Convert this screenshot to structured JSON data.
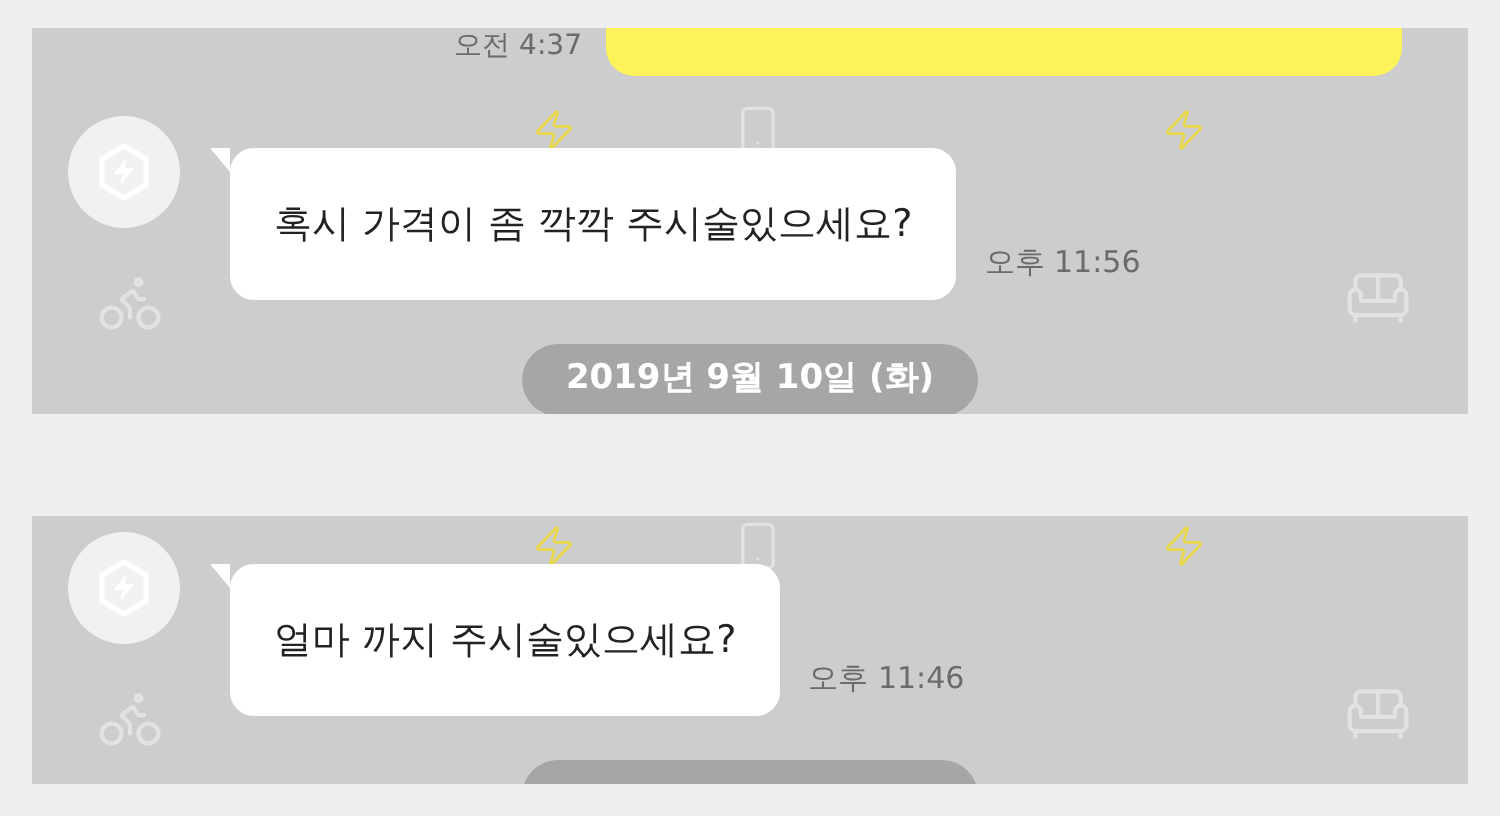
{
  "panels": [
    {
      "items": [
        {
          "kind": "outgoing",
          "time": "오전 4:37"
        },
        {
          "kind": "incoming",
          "text": "혹시 가격이 좀 깍깍 주시술있으세요?",
          "time": "오후 11:56"
        },
        {
          "kind": "date",
          "text": "2019년 9월 10일 (화)"
        }
      ]
    },
    {
      "items": [
        {
          "kind": "incoming",
          "text": "얼마 까지 주시술있으세요?",
          "time": "오후 11:46"
        },
        {
          "kind": "date"
        }
      ]
    }
  ]
}
